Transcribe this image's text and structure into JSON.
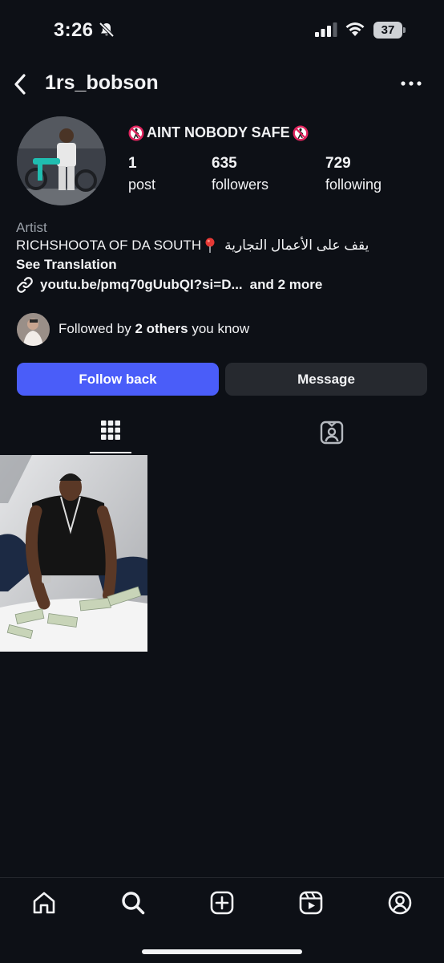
{
  "status_bar": {
    "time": "3:26",
    "battery_level": "37"
  },
  "header": {
    "username": "1rs_bobson"
  },
  "profile": {
    "bio_title": "AINT NOBODY SAFE",
    "stats": [
      {
        "value": "1",
        "label": "post"
      },
      {
        "value": "635",
        "label": "followers"
      },
      {
        "value": "729",
        "label": "following"
      }
    ],
    "category": "Artist",
    "bio_line": "RICHSHOOTA OF DA SOUTH",
    "bio_arabic": "يقف على الأعمال التجارية",
    "see_translation": "See Translation",
    "link": "youtu.be/pmq70gUubQI?si=D...",
    "link_more": "and 2 more",
    "followed_by_prefix": "Followed by",
    "followed_by_bold": "2 others",
    "followed_by_suffix": "you know"
  },
  "actions": {
    "follow_back": "Follow back",
    "message": "Message"
  },
  "tabs": [
    "grid-icon",
    "tagged-icon"
  ],
  "bottom_nav": [
    "home-icon",
    "search-icon",
    "create-icon",
    "reels-icon",
    "profile-icon"
  ],
  "colors": {
    "background": "#0d1016",
    "follow_button": "#4a5df9",
    "message_button": "#26292f",
    "no_sign": "#e0245e"
  }
}
